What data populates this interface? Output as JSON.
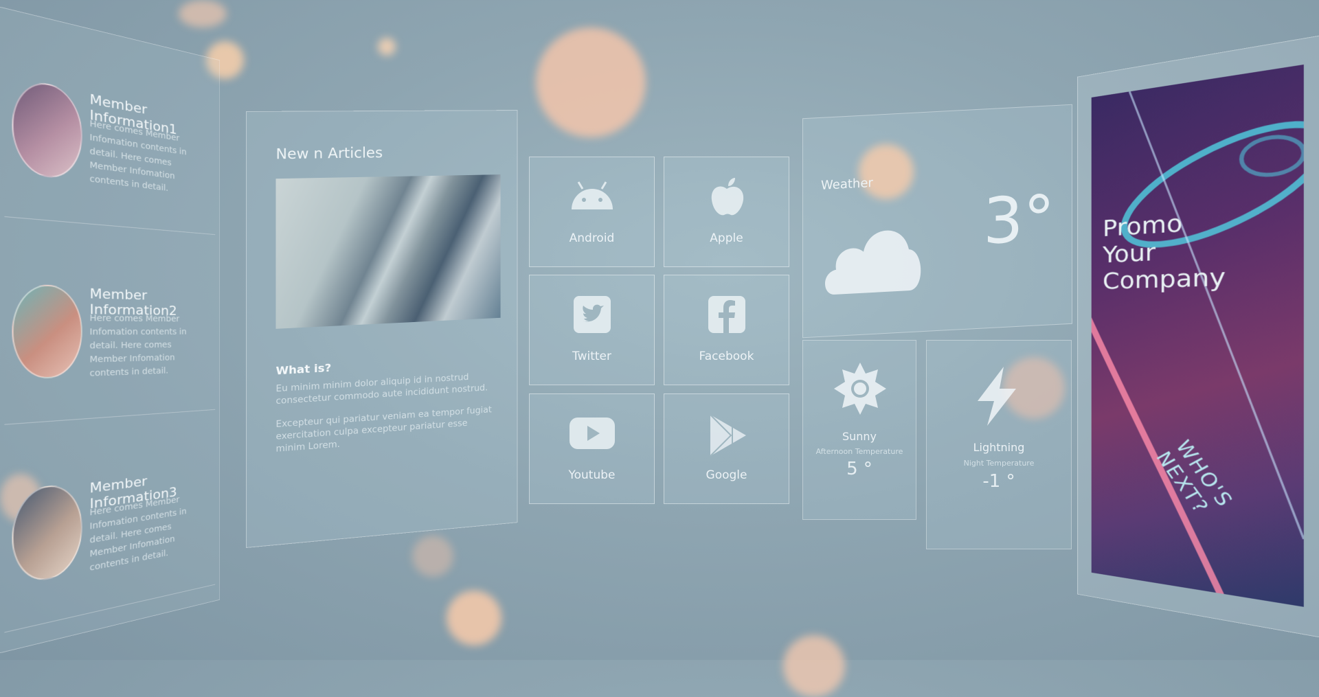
{
  "members": [
    {
      "title": "Member Information1",
      "desc": "Here comes Member Infomation contents in detail. Here comes Member Infomation contents in detail."
    },
    {
      "title": "Member Information2",
      "desc": "Here comes Member Infomation contents in detail. Here comes Member Infomation contents in detail."
    },
    {
      "title": "Member Information3",
      "desc": "Here comes Member Infomation contents in detail. Here comes Member Infomation contents in detail."
    }
  ],
  "articles": {
    "heading": "New n Articles",
    "question": "What is?",
    "para1": "Eu minim minim dolor aliquip id in nostrud consectetur commodo aute incididunt nostrud.",
    "para2": "Excepteur qui pariatur veniam ea tempor fugiat exercitation culpa excepteur pariatur esse minim Lorem."
  },
  "tiles": [
    {
      "label": "Android",
      "icon": "android-icon"
    },
    {
      "label": "Apple",
      "icon": "apple-icon"
    },
    {
      "label": "Twitter",
      "icon": "twitter-icon"
    },
    {
      "label": "Facebook",
      "icon": "facebook-icon"
    },
    {
      "label": "Youtube",
      "icon": "youtube-icon"
    },
    {
      "label": "Google",
      "icon": "google-play-icon"
    }
  ],
  "weather": {
    "title": "Weather",
    "temperature": "3°",
    "icon": "cloud-icon",
    "sunny": {
      "name": "Sunny",
      "sub": "Afternoon Temperature",
      "value": "5 °",
      "icon": "sun-icon"
    },
    "lightning": {
      "name": "Lightning",
      "sub": "Night Temperature",
      "value": "-1 °",
      "icon": "lightning-icon"
    }
  },
  "promo": {
    "title_line1": "Promo",
    "title_line2": "Your",
    "title_line3": "Company",
    "tagline": "WHO'S NEXT?"
  },
  "colors": {
    "accent": "#9fb6c0",
    "bokeh": "#ffc9a3",
    "promo_magenta": "#7a3a6a",
    "promo_cyan": "#4fd7e8"
  }
}
